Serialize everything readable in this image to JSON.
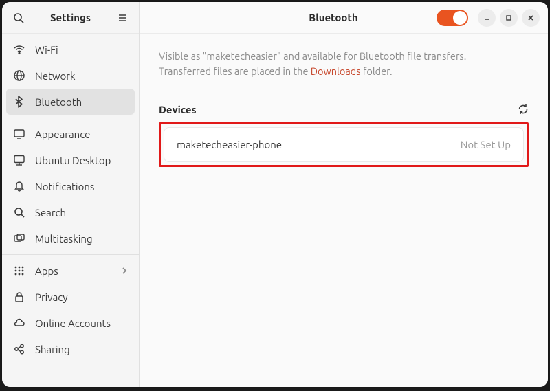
{
  "sidebar": {
    "title": "Settings",
    "items": [
      {
        "label": "Wi-Fi"
      },
      {
        "label": "Network"
      },
      {
        "label": "Bluetooth"
      },
      {
        "label": "Appearance"
      },
      {
        "label": "Ubuntu Desktop"
      },
      {
        "label": "Notifications"
      },
      {
        "label": "Search"
      },
      {
        "label": "Multitasking"
      },
      {
        "label": "Apps"
      },
      {
        "label": "Privacy"
      },
      {
        "label": "Online Accounts"
      },
      {
        "label": "Sharing"
      }
    ]
  },
  "header": {
    "title": "Bluetooth"
  },
  "description": {
    "line1a": "Visible as \"",
    "hostname": "maketecheasier",
    "line1b": "\" and available for Bluetooth file transfers.",
    "line2a": "Transferred files are placed in the ",
    "link": "Downloads",
    "line2b": " folder."
  },
  "devices": {
    "title": "Devices",
    "list": [
      {
        "name": "maketecheasier-phone",
        "status": "Not Set Up"
      }
    ]
  }
}
